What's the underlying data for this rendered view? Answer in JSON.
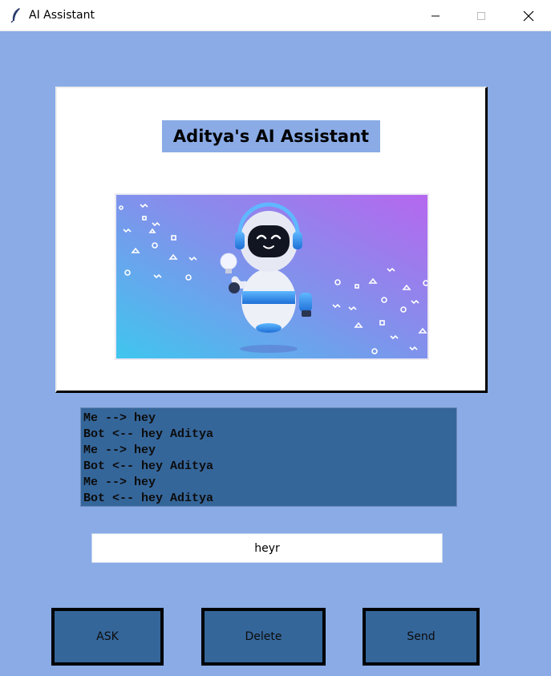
{
  "window": {
    "title": "AI Assistant"
  },
  "header": {
    "title": "Aditya's AI Assistant"
  },
  "chat": {
    "lines": [
      "Me --> hey",
      "Bot <-- hey Aditya",
      "Me --> hey",
      "Bot <-- hey Aditya",
      "Me --> hey",
      "Bot <-- hey Aditya"
    ]
  },
  "input": {
    "value": "heyr"
  },
  "buttons": {
    "ask": "ASK",
    "delete": "Delete",
    "send": "Send"
  },
  "colors": {
    "background": "#8aabe6",
    "panel": "#35669a",
    "card": "#ffffff"
  }
}
